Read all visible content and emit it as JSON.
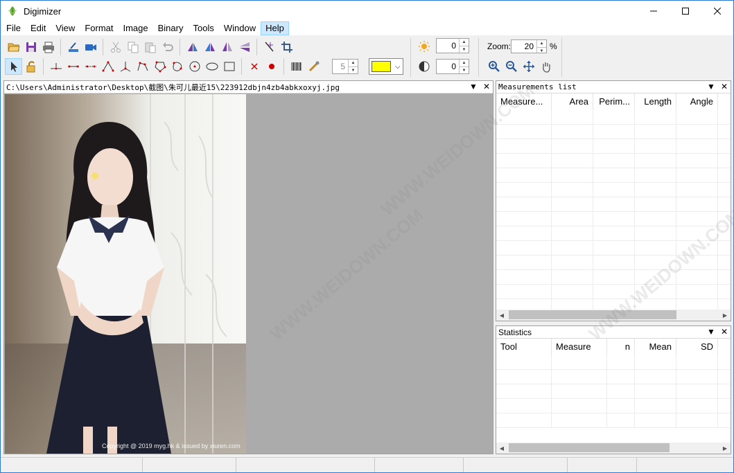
{
  "window": {
    "title": "Digimizer",
    "controls": [
      "minimize-icon",
      "maximize-icon",
      "close-icon"
    ]
  },
  "menu": [
    "File",
    "Edit",
    "View",
    "Format",
    "Image",
    "Binary",
    "Tools",
    "Window",
    "Help"
  ],
  "toolbar": {
    "brightness_value": "0",
    "contrast_value": "0",
    "zoom_label": "Zoom:",
    "zoom_value": "20",
    "zoom_unit": "%",
    "line_width_value": "5",
    "color": "#ffff00"
  },
  "image_window": {
    "path": "C:\\Users\\Administrator\\Desktop\\截图\\朱可儿最近15\\223912dbjn4zb4abkxoxyj.jpg",
    "copyright": "Copyright @ 2019 myg.hk & issued by xiuren.com"
  },
  "measurements": {
    "title": "Measurements list",
    "columns": [
      "Measure...",
      "Area",
      "Perim...",
      "Length",
      "Angle"
    ]
  },
  "statistics": {
    "title": "Statistics",
    "columns": [
      "Tool",
      "Measure",
      "n",
      "Mean",
      "SD"
    ]
  },
  "watermark": "WWW.WEIDOWN.COM"
}
